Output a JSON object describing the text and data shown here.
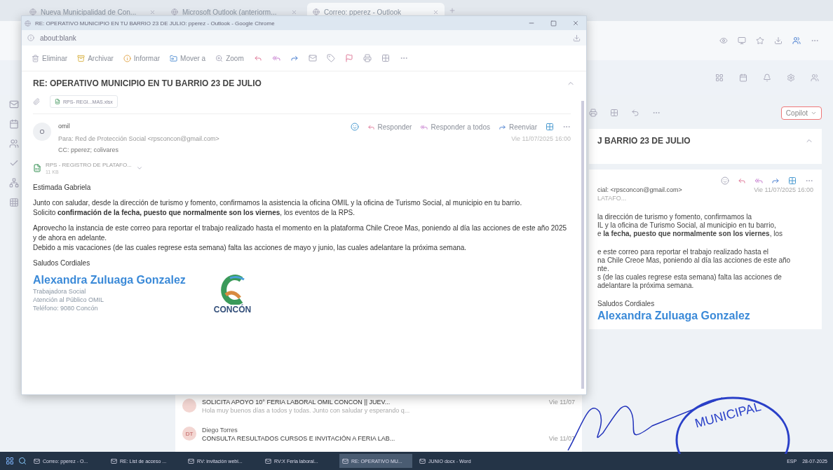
{
  "browser": {
    "tabs": [
      {
        "label": "Nueva Municipalidad de Con...",
        "selected": false
      },
      {
        "label": "Microsoft Outlook (anteriorm...",
        "selected": false
      },
      {
        "label": "Correo: pperez - Outlook",
        "selected": true
      }
    ]
  },
  "message_list": [
    {
      "subject": "SOLICITA APOYO 10° FERIA LABORAL OMIL CONCON || JUEV...",
      "date": "Vie 11/07",
      "preview": "Hola muy buenos días a todos y todas. Junto con saludar y esperando q..."
    },
    {
      "avatar": "DT",
      "sender": "Diego Torres",
      "subject": "CONSULTA RESULTADOS CURSOS E INVITACIÓN A FERIA LAB...",
      "date": "Vie 11/07"
    }
  ],
  "reading_pane": {
    "copilot": "Copilot",
    "subject": "J BARRIO 23 DE JULIO",
    "to": "cial: <rpsconcon@gmail.com>",
    "date": "Vie 11/07/2025 16:00",
    "attachment": "LATAFO...",
    "paragraphs": [
      [
        "la dirección de turismo y fomento, confirmamos la",
        "IL y la oficina de Turismo Social, al municipio en tu barrio,",
        "e **la fecha, puesto que normalmente son los viernes**, los"
      ],
      [
        "e este correo para reportar el trabajo realizado hasta el",
        "na Chile Creoe Mas, poniendo al día las acciones de este año",
        "nte.",
        "s (de las cuales regrese esta semana) falta las acciones de",
        "adelantare la próxima semana."
      ]
    ],
    "closing": "Saludos Cordiales",
    "signature": "Alexandra Zuluaga Gonzalez"
  },
  "stamp": {
    "text": "MUNICIPAL"
  },
  "popup": {
    "title": "RE: OPERATIVO MUNICIPIO EN TU BARRIO 23 DE JULIO: pperez - Outlook - Google Chrome",
    "address": "about:blank",
    "toolbar": [
      "Eliminar",
      "Archivar",
      "Informar",
      "Mover a",
      "Zoom"
    ],
    "subject": "RE: OPERATIVO MUNICIPIO EN TU BARRIO 23 DE JULIO",
    "attachment_top": "RPS- REGI...MAS.xlsx",
    "avatar": "O",
    "sender": "omil",
    "to": "Para: Red de Protección Social <rpsconcon@gmail.com>",
    "cc": "CC: pperez; colivares",
    "actions": [
      "Responder",
      "Responder a todos",
      "Reenviar"
    ],
    "date": "Vie 11/07/2025 16:00",
    "attachment": {
      "name": "RPS - REGISTRO DE PLATAFO...",
      "size": "11 KB"
    },
    "greeting": "Estimada Gabriela",
    "paragraphs": [
      [
        "Junto con saludar, desde la dirección de turismo y fomento, confirmamos la asistencia la oficina OMIL y la oficina de Turismo Social, al municipio en tu barrio.",
        "Solicito **confirmación de la fecha, puesto que normalmente son los viernes**, los eventos de la RPS."
      ],
      [
        "Aprovecho la instancia de este correo para reportar el trabajo realizado hasta el momento en la plataforma Chile Creoe Mas, poniendo al día las acciones de este año 2025 y de ahora en adelante.",
        "Debido a mis vacaciones (de las cuales regrese esta semana) falta las acciones de mayo y junio, las cuales adelantare la próxima semana."
      ]
    ],
    "closing": "Saludos Cordiales",
    "signature_name": "Alexandra Zuluaga Gonzalez",
    "signature_lines": [
      "Trabajadora Social",
      "Atención al Público OMIL",
      "Teléfono: 9080 Concón"
    ],
    "logo": "CONCÓN"
  },
  "taskbar": {
    "apps": [
      {
        "label": "Correo: pperez - O...",
        "selected": false
      },
      {
        "label": "RE: List de acceso ...",
        "selected": false
      },
      {
        "label": "RV: invitación webi...",
        "selected": false
      },
      {
        "label": "RV:X Feria laboral...",
        "selected": false
      },
      {
        "label": "RE: OPERATIVO MU...",
        "selected": true
      },
      {
        "label": "JUNIO docx - Word",
        "selected": false
      }
    ],
    "language": "ESP",
    "date": "28-07-2025"
  }
}
